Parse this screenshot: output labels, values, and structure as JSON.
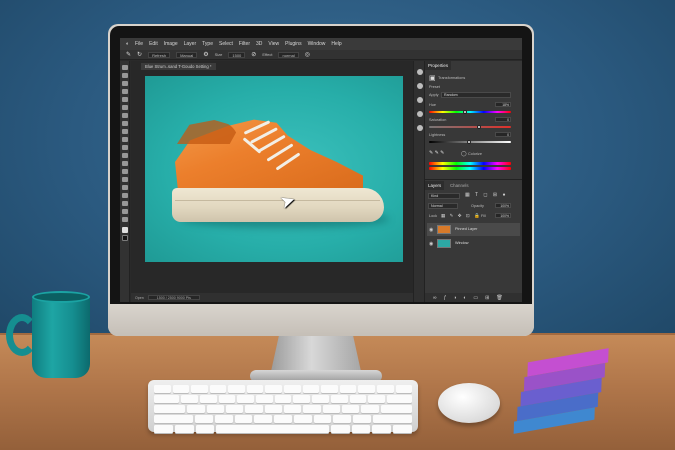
{
  "app": {
    "menu": [
      "File",
      "Edit",
      "Image",
      "Layer",
      "Type",
      "Select",
      "Filter",
      "3D",
      "View",
      "Plugins",
      "Window",
      "Help"
    ],
    "options": {
      "mode_label": "Refresh",
      "mode_value": "Manual",
      "size_label": "Size",
      "size_value": "1500",
      "effect_label": "Effect",
      "effect_value": "normal"
    },
    "document_tab": "Blue Strum..sand T-Goudo Setting *",
    "status": {
      "zoom": "Open",
      "doc": "1500 / 2500 9000 Pts"
    }
  },
  "properties": {
    "tab": "Properties",
    "section_icon_label": "Transformations",
    "group_label": "Preset",
    "apply_label": "Apply",
    "apply_value": "Random",
    "hue_label": "Hue",
    "hue_value": "18%",
    "saturation_label": "Saturation",
    "saturation_value": "0",
    "lightness_label": "Lightness",
    "lightness_value": "0",
    "colorize_label": "Colorize"
  },
  "layers": {
    "tabs": [
      "Layers",
      "Channels"
    ],
    "kind_label": "Kind",
    "blend_mode": "Normal",
    "opacity_label": "Opacity",
    "opacity_value": "100%",
    "lock_label": "Lock",
    "fill_label": "Fill",
    "fill_value": "100%",
    "items": [
      {
        "name": "Pinned Layer",
        "thumb_color": "#d87a2a"
      },
      {
        "name": "Window",
        "thumb_color": "#2ca8a4"
      }
    ]
  },
  "colors": {
    "canvas_bg": "#2bb3ae",
    "shoe": "#ec7f2c",
    "mug": "#1ea5a4",
    "swatches": [
      "#c44fd1",
      "#9a52c8",
      "#6a5fcf",
      "#4a6dc9",
      "#3f88d0"
    ]
  }
}
